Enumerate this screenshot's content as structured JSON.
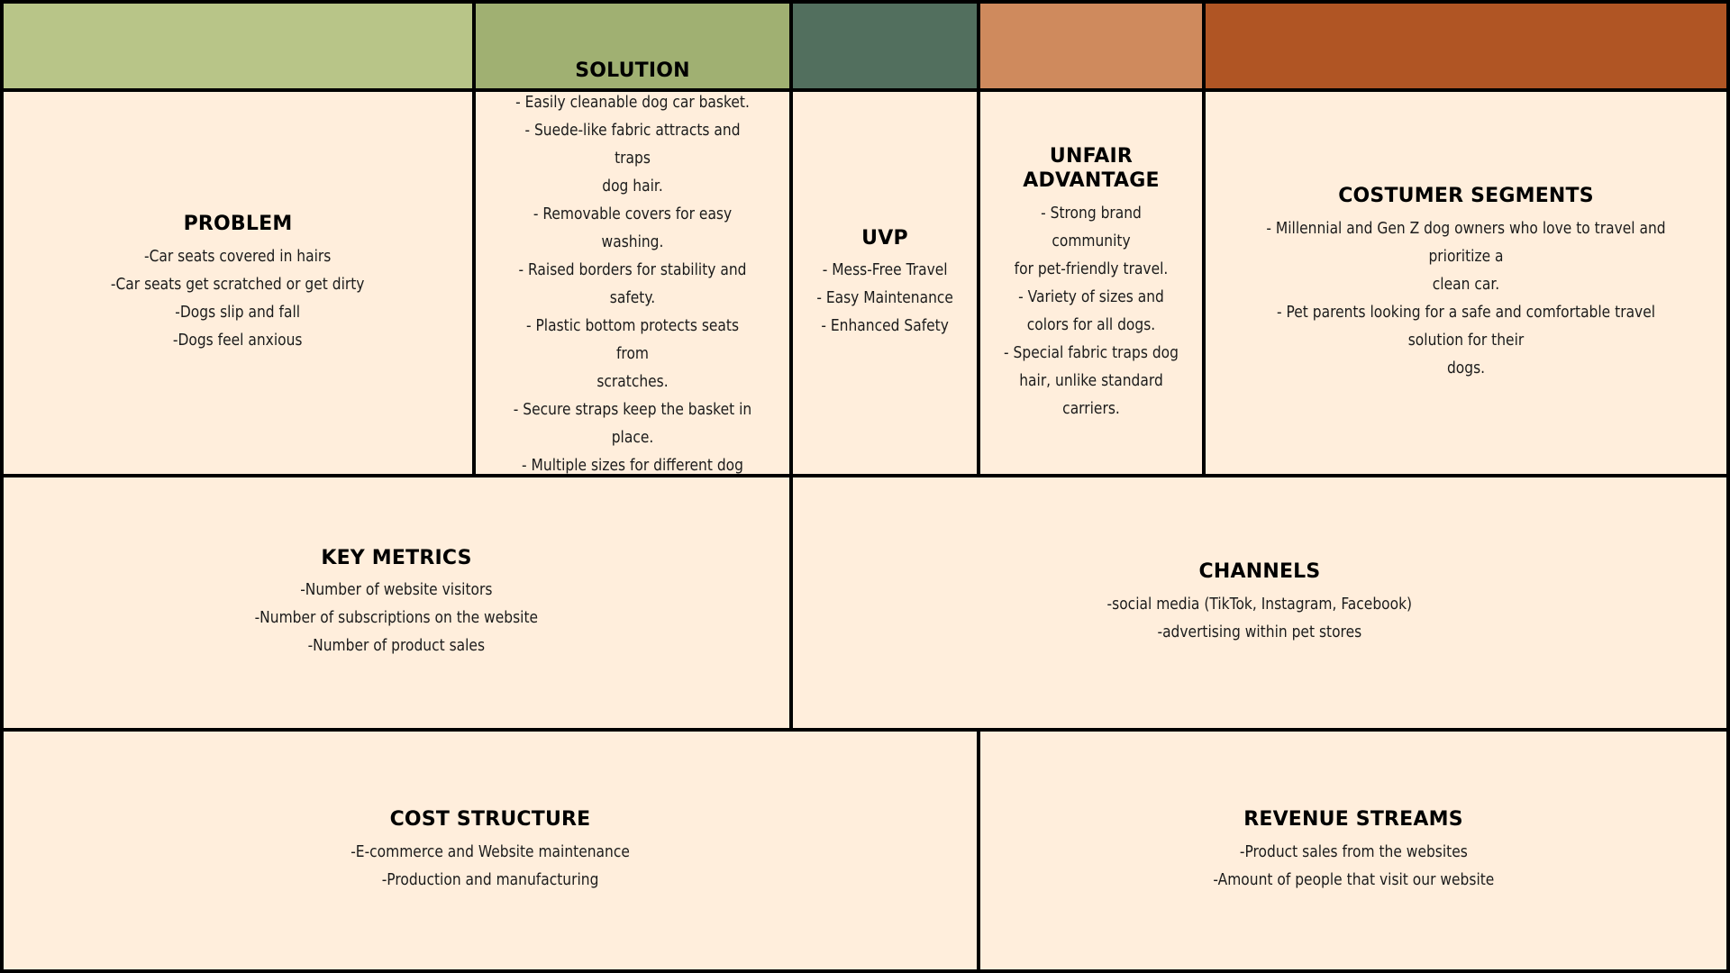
{
  "colors": {
    "band_1": "#B8C588",
    "band_2": "#A0B072",
    "band_3": "#526F5E",
    "band_4": "#CF8A5D",
    "band_5": "#B05524",
    "box_fill": "#FFEEDC",
    "border": "#000000"
  },
  "problem": {
    "title": "PROBLEM",
    "items": [
      "-Car seats covered in hairs",
      "-Car seats get scratched or get dirty",
      "-Dogs slip and fall",
      "-Dogs feel anxious"
    ]
  },
  "solution": {
    "title": "SOLUTION",
    "items": [
      "- Easily cleanable dog car basket.",
      "- Suede-like fabric attracts and traps",
      "dog hair.",
      "- Removable covers for easy washing.",
      "- Raised borders for stability and safety.",
      "- Plastic bottom protects seats from",
      "scratches.",
      "- Secure straps keep the basket in place.",
      "- Multiple sizes for different dog breeds"
    ]
  },
  "uvp": {
    "title": "UVP",
    "items": [
      "- Mess-Free Travel",
      "- Easy Maintenance",
      "- Enhanced Safety"
    ]
  },
  "unfair_advantage": {
    "title": "UNFAIR ADVANTAGE",
    "items": [
      "- Strong brand community",
      "for pet-friendly travel.",
      "- Variety of sizes and",
      "colors for all dogs.",
      "- Special fabric traps dog",
      "hair, unlike standard",
      "carriers."
    ]
  },
  "customer_segments": {
    "title": "COSTUMER SEGMENTS",
    "items": [
      "- Millennial and Gen Z dog owners who love to travel and prioritize a",
      "clean car.",
      "- Pet parents looking for a safe and comfortable travel solution for their",
      "dogs."
    ]
  },
  "key_metrics": {
    "title": "KEY METRICS",
    "items": [
      "-Number of website visitors",
      "-Number of subscriptions on the website",
      "-Number of product sales"
    ]
  },
  "channels": {
    "title": "CHANNELS",
    "items": [
      "-social media (TikTok, Instagram, Facebook)",
      "-advertising within pet stores"
    ]
  },
  "cost_structure": {
    "title": "COST STRUCTURE",
    "items": [
      "-E-commerce and Website maintenance",
      "-Production and manufacturing"
    ]
  },
  "revenue_streams": {
    "title": "REVENUE STREAMS",
    "items": [
      "-Product sales from the websites",
      "-Amount of people that visit our website"
    ]
  }
}
